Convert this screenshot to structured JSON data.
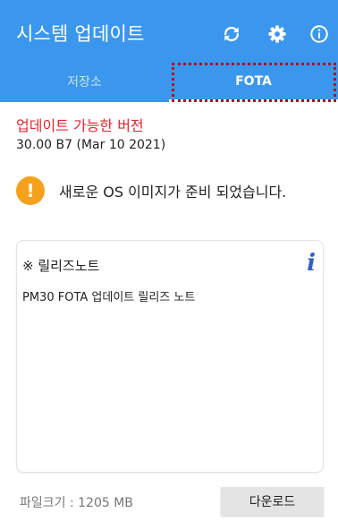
{
  "app_bar": {
    "title": "시스템 업데이트",
    "background_color": "#3b97ee",
    "actions": [
      {
        "icon": "refresh-icon"
      },
      {
        "icon": "settings-gear-icon"
      },
      {
        "icon": "info-circle-icon"
      }
    ]
  },
  "tabs": [
    {
      "label": "저장소",
      "selected": false
    },
    {
      "label": "FOTA",
      "selected": true
    }
  ],
  "update": {
    "heading": "업데이트 가능한 버전",
    "heading_color": "#e3262f",
    "version": "30.00 B7 (Mar 10 2021)"
  },
  "notice": {
    "icon_symbol": "!",
    "icon_color": "#f6a11c",
    "text": "새로운 OS 이미지가 준비 되었습니다."
  },
  "release_notes": {
    "title": "※ 릴리즈노트",
    "info_icon": "i",
    "body": "PM30 FOTA 업데이트 릴리즈 노트"
  },
  "footer": {
    "file_size": "파일크기 : 1205 MB",
    "download_label": "다운로드"
  }
}
